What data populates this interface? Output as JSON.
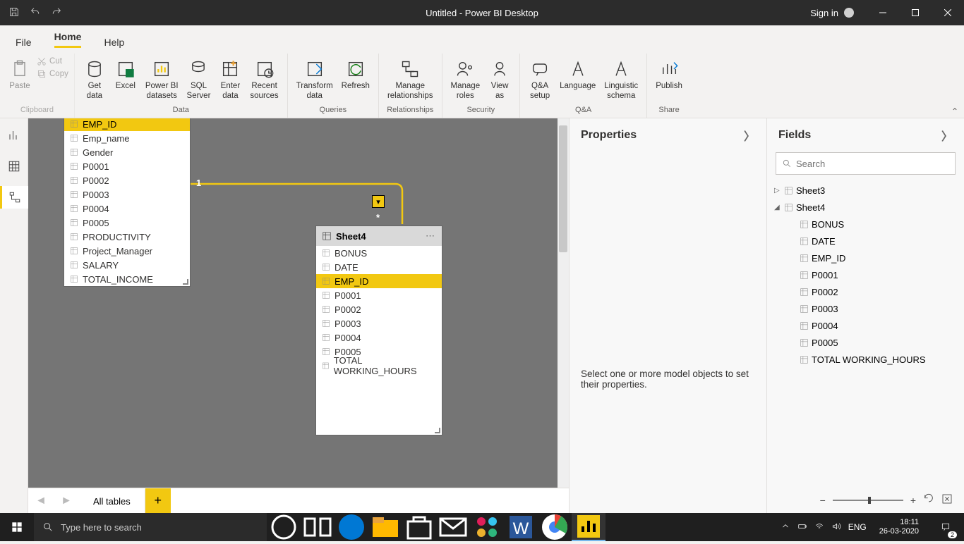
{
  "titlebar": {
    "title": "Untitled - Power BI Desktop",
    "signin": "Sign in"
  },
  "menu": {
    "file": "File",
    "home": "Home",
    "help": "Help"
  },
  "ribbon": {
    "clipboard": {
      "paste": "Paste",
      "cut": "Cut",
      "copy": "Copy",
      "label": "Clipboard"
    },
    "data": {
      "get": "Get\ndata",
      "excel": "Excel",
      "pbi": "Power BI\ndatasets",
      "sql": "SQL\nServer",
      "enter": "Enter\ndata",
      "recent": "Recent\nsources",
      "label": "Data"
    },
    "queries": {
      "transform": "Transform\ndata",
      "refresh": "Refresh",
      "label": "Queries"
    },
    "relationships": {
      "manage": "Manage\nrelationships",
      "label": "Relationships"
    },
    "security": {
      "roles": "Manage\nroles",
      "view": "View\nas",
      "label": "Security"
    },
    "qa": {
      "setup": "Q&A\nsetup",
      "lang": "Language\n",
      "ling": "Linguistic\nschema",
      "label": "Q&A"
    },
    "share": {
      "publish": "Publish",
      "label": "Share"
    }
  },
  "canvas": {
    "table1": {
      "fields": [
        "EMP_ID",
        "Emp_name",
        "Gender",
        "P0001",
        "P0002",
        "P0003",
        "P0004",
        "P0005",
        "PRODUCTIVITY",
        "Project_Manager",
        "SALARY",
        "TOTAL_INCOME"
      ],
      "selected": "EMP_ID"
    },
    "table2": {
      "name": "Sheet4",
      "fields": [
        "BONUS",
        "DATE",
        "EMP_ID",
        "P0001",
        "P0002",
        "P0003",
        "P0004",
        "P0005",
        "TOTAL WORKING_HOURS"
      ],
      "selected": "EMP_ID"
    },
    "rel": {
      "from": "1",
      "to": "*"
    }
  },
  "bottombar": {
    "tab": "All tables"
  },
  "properties": {
    "title": "Properties",
    "body": "Select one or more model objects to set their properties."
  },
  "fields": {
    "title": "Fields",
    "search_placeholder": "Search",
    "sheet3": "Sheet3",
    "sheet4": "Sheet4",
    "sheet4_fields": [
      "BONUS",
      "DATE",
      "EMP_ID",
      "P0001",
      "P0002",
      "P0003",
      "P0004",
      "P0005",
      "TOTAL WORKING_HOURS"
    ]
  },
  "taskbar": {
    "search": "Type here to search",
    "lang": "ENG",
    "time": "18:11",
    "date": "26-03-2020",
    "notif_count": "2"
  }
}
